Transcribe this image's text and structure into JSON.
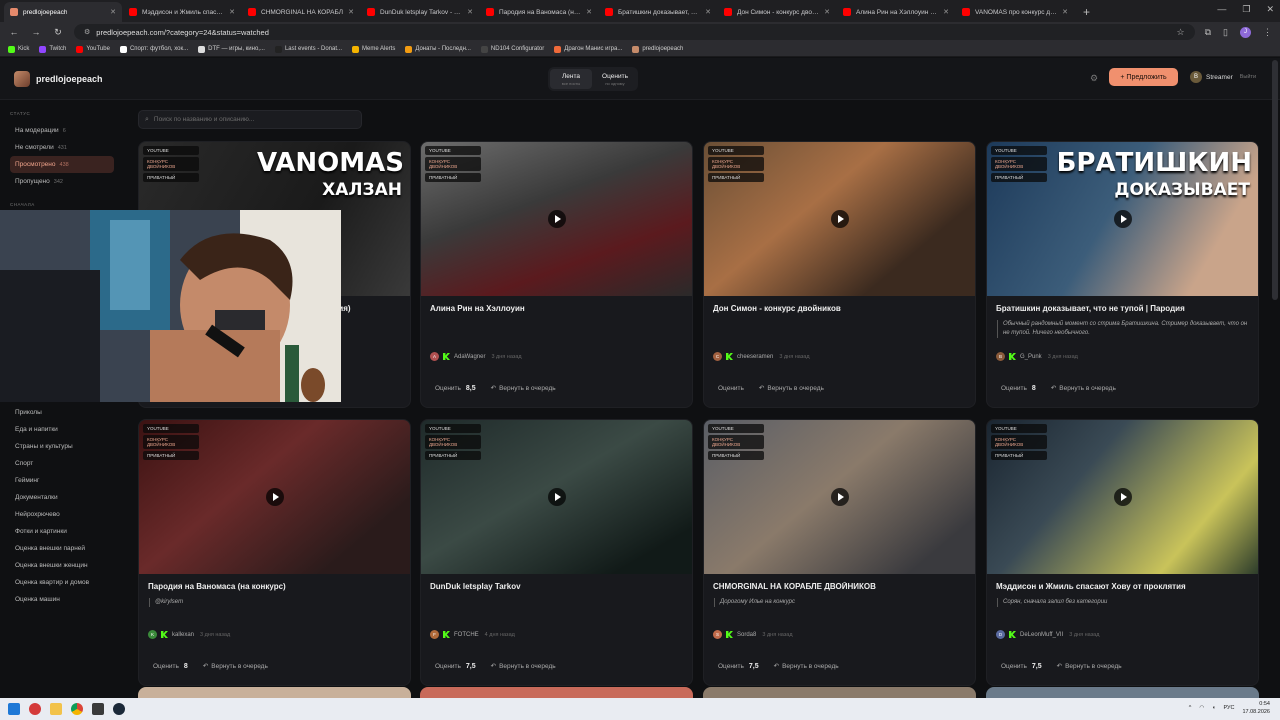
{
  "browser": {
    "tabs": [
      {
        "title": "predlojoepeach",
        "color": "#e58a6c",
        "active": true
      },
      {
        "title": "Мэддисон и Жмиль спасают Хо",
        "color": "#ff0000",
        "active": false
      },
      {
        "title": "CHMORGINAL НА КОРАБЛ",
        "color": "#ff0000",
        "active": false
      },
      {
        "title": "DunDuk letsplay Tarkov - YouT",
        "color": "#ff0000",
        "active": false
      },
      {
        "title": "Пародия на Ваномаса (на конк",
        "color": "#ff0000",
        "active": false
      },
      {
        "title": "Братишкин доказывает, что н",
        "color": "#ff0000",
        "active": false
      },
      {
        "title": "Дон Симон - конкурс двойник",
        "color": "#ff0000",
        "active": false
      },
      {
        "title": "Алина Рин на Хэллоуин - YouT",
        "color": "#ff0000",
        "active": false
      },
      {
        "title": "VANOMAS про конкурс двой",
        "color": "#ff0000",
        "active": false
      }
    ],
    "new_tab": "+",
    "url": "predlojoepeach.com/?category=24&status=watched",
    "bookmarks": [
      {
        "label": "Kick",
        "color": "#53fc18"
      },
      {
        "label": "Twitch",
        "color": "#9146ff"
      },
      {
        "label": "YouTube",
        "color": "#ff0000"
      },
      {
        "label": "Спорт: футбол, хок...",
        "color": "#ffffff"
      },
      {
        "label": "DTF — игры, кино,...",
        "color": "#dddddd"
      },
      {
        "label": "Last events - Donat...",
        "color": "#222222"
      },
      {
        "label": "Meme Alerts",
        "color": "#f5b400"
      },
      {
        "label": "Донаты - Последн...",
        "color": "#f39c12"
      },
      {
        "label": "ND104 Configurator",
        "color": "#444444"
      },
      {
        "label": "Драгон Манис игра...",
        "color": "#ef6a3a"
      },
      {
        "label": "predlojoepeach",
        "color": "#c58b6a"
      }
    ]
  },
  "header": {
    "brand": "predlojoepeach",
    "segments": [
      {
        "main": "Лента",
        "sub": "все посты",
        "active": true
      },
      {
        "main": "Оценить",
        "sub": "по одному",
        "active": false
      }
    ],
    "propose_label": "+ Предложить",
    "user_initial": "B",
    "user_name": "Streamer",
    "logout": "Выйти"
  },
  "sidebar": {
    "status_heading": "СТАТУС",
    "statuses": [
      {
        "label": "На модерации",
        "count": "6",
        "active": false
      },
      {
        "label": "Не смотрели",
        "count": "431",
        "active": false
      },
      {
        "label": "Просмотрено",
        "count": "438",
        "active": true
      },
      {
        "label": "Пропущено",
        "count": "342",
        "active": false
      }
    ],
    "sort_heading": "СНАЧАЛА",
    "categories": [
      "Приколы",
      "Еда и напитки",
      "Страны и культуры",
      "Спорт",
      "Гейминг",
      "Документалки",
      "Нейрохрючево",
      "Фотки и картинки",
      "Оценка внешки парней",
      "Оценка внешки женщин",
      "Оценка квартир и домов",
      "Оценка машин"
    ]
  },
  "search": {
    "placeholder": "Поиск по названию и описанию..."
  },
  "badges": {
    "source": "YOUTUBE",
    "category": "КОНКУРС ДВОЙНИКОВ",
    "privacy": "ПРИВАТНЫЙ"
  },
  "labels": {
    "rate": "Оценить",
    "requeue": "Вернуть в очередь"
  },
  "cards": [
    {
      "title": "VANOMAS про конкурс двойников (полная версия)",
      "desc": "",
      "author": "",
      "author_initial": "",
      "ago": "",
      "score": "",
      "thumb": "linear-gradient(120deg,#2a2a2a,#1a1a1a 60%,#3a3a3a)",
      "av_color": "#888",
      "thumb_title": "VANOMAS",
      "thumb_sub": "ХАЛЗАН"
    },
    {
      "title": "Алина Рин на Хэллоуин",
      "desc": "",
      "author": "AdaWagner",
      "author_initial": "A",
      "ago": "3 дня назад",
      "score": "8,5",
      "thumb": "linear-gradient(160deg,#6d6d6d,#3a3a3a 40%,#5b1a1e 70%,#2a2a2a)",
      "av_color": "#b05050"
    },
    {
      "title": "Дон Симон - конкурс двойников",
      "desc": "",
      "author": "cheeseramen",
      "author_initial": "C",
      "ago": "3 дня назад",
      "score": "",
      "thumb": "linear-gradient(140deg,#6a4f36,#a86f45 40%,#3b2a1f 75%)",
      "av_color": "#a06040"
    },
    {
      "title": "Братишкин доказывает, что не тупой | Пародия",
      "desc": "Обычный рандомный момент со стрима Братишкина. Стример доказывает, что он не тупой. Ничего необычного.",
      "author": "G_Punk",
      "author_initial": "B",
      "ago": "3 дня назад",
      "score": "8",
      "thumb": "linear-gradient(120deg,#1d3a5a,#3c5d7a 45%,#c9a48a 80%)",
      "av_color": "#8a5a3a",
      "thumb_title": "БРАТИШКИН",
      "thumb_sub": "ДОКАЗЫВАЕТ"
    },
    {
      "title": "Пародия на Ваномаса (на конкурс)",
      "desc": "@kirylsem",
      "author": "kallexan",
      "author_initial": "K",
      "ago": "3 дня назад",
      "score": "8",
      "thumb": "linear-gradient(140deg,#3b1212,#6a2a2a 40%,#2a1b1b 80%)",
      "av_color": "#3a8a3a"
    },
    {
      "title": "DunDuk letsplay Tarkov",
      "desc": "",
      "author": "FOTCHE",
      "author_initial": "F",
      "ago": "4 дня назад",
      "score": "7,5",
      "thumb": "linear-gradient(150deg,#1f2a2a,#3b4a45 45%,#111a18 85%)",
      "av_color": "#b06a3a"
    },
    {
      "title": "CHMORGINAL НА КОРАБЛЕ ДВОЙНИКОВ",
      "desc": "Дорогому Илье на конкурс",
      "author": "Sorda8",
      "author_initial": "S",
      "ago": "3 дня назад",
      "score": "7,5",
      "thumb": "linear-gradient(140deg,#5a5e66,#8a7a6a 45%,#3a3a3e 85%)",
      "av_color": "#c06a4a"
    },
    {
      "title": "Мэддисон и Жмиль спасают Хову от проклятия",
      "desc": "Сорян, сначала залил без категории",
      "author": "DeLeonMuff_VII",
      "author_initial": "D",
      "ago": "3 дня назад",
      "score": "7,5",
      "thumb": "linear-gradient(130deg,#1a2530,#3a4a55 35%,#c9c35a 75%,#2a3a2a)",
      "av_color": "#5a6aa0"
    }
  ],
  "taskbar": {
    "lang": "РУС",
    "time": "0:54",
    "date": "17.08.2026"
  }
}
